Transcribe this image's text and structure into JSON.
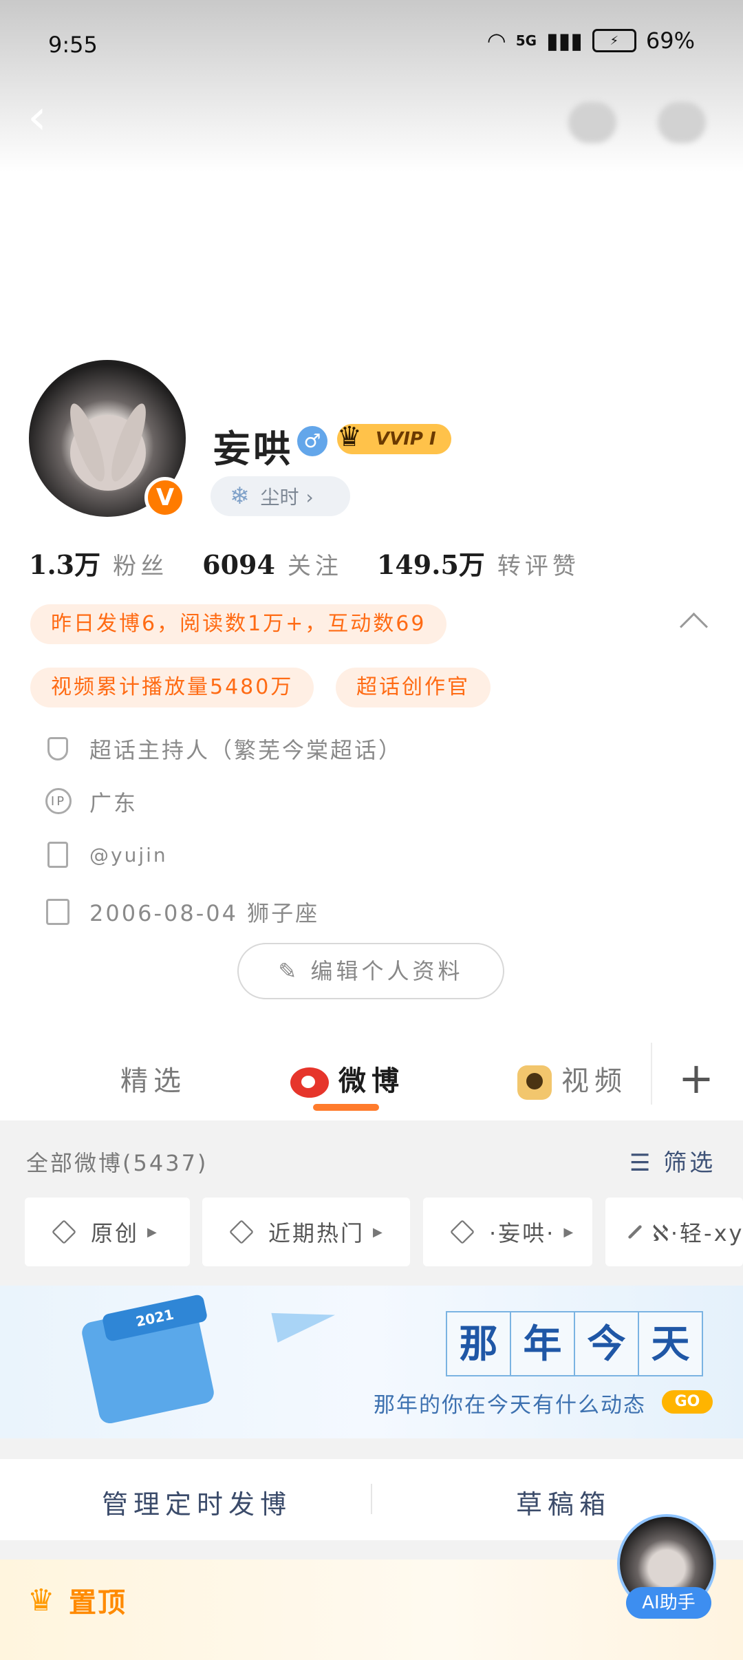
{
  "status_bar": {
    "time": "9:55",
    "network": "5G",
    "battery": "69%"
  },
  "profile": {
    "name": "妄哄",
    "gender_symbol": "♂",
    "vip_label": "VVIP I",
    "verified_badge": "V",
    "dust_label": "尘时",
    "stats": [
      {
        "value": "1.3万",
        "label": "粉丝"
      },
      {
        "value": "6094",
        "label": "关注"
      },
      {
        "value": "149.5万",
        "label": "转评赞"
      }
    ],
    "highlights": [
      "昨日发博6，阅读数1万+，互动数69",
      "视频累计播放量5480万",
      "超话创作官"
    ],
    "info": [
      {
        "icon": "shield-icon",
        "text": "超话主持人（繁芜今棠超话）"
      },
      {
        "icon": "ip-icon",
        "text": "广东"
      },
      {
        "icon": "document-icon",
        "text": "@yujin"
      },
      {
        "icon": "calendar-icon",
        "text": "2006-08-04 狮子座"
      }
    ],
    "edit_button": "编辑个人资料"
  },
  "tabs": [
    {
      "label": "精选"
    },
    {
      "label": "微博"
    },
    {
      "label": "视频"
    }
  ],
  "feed": {
    "all_title": "全部微博(5437)",
    "filter_label": "筛选",
    "chips": [
      "原创",
      "近期热门",
      "·妄哄·",
      "ℵ·轻-xy"
    ]
  },
  "banner": {
    "calendar_year": "2021",
    "title_chars": [
      "那",
      "年",
      "今",
      "天"
    ],
    "subtitle": "那年的你在今天有什么动态",
    "go_label": "GO"
  },
  "manage": {
    "scheduled": "管理定时发博",
    "drafts": "草稿箱"
  },
  "pinned_label": "置顶",
  "ai_assistant": "AI助手",
  "colors": {
    "accent_orange": "#ff7b2c",
    "link_blue": "#3d8ef0",
    "pill_bg": "#ffefe4"
  }
}
